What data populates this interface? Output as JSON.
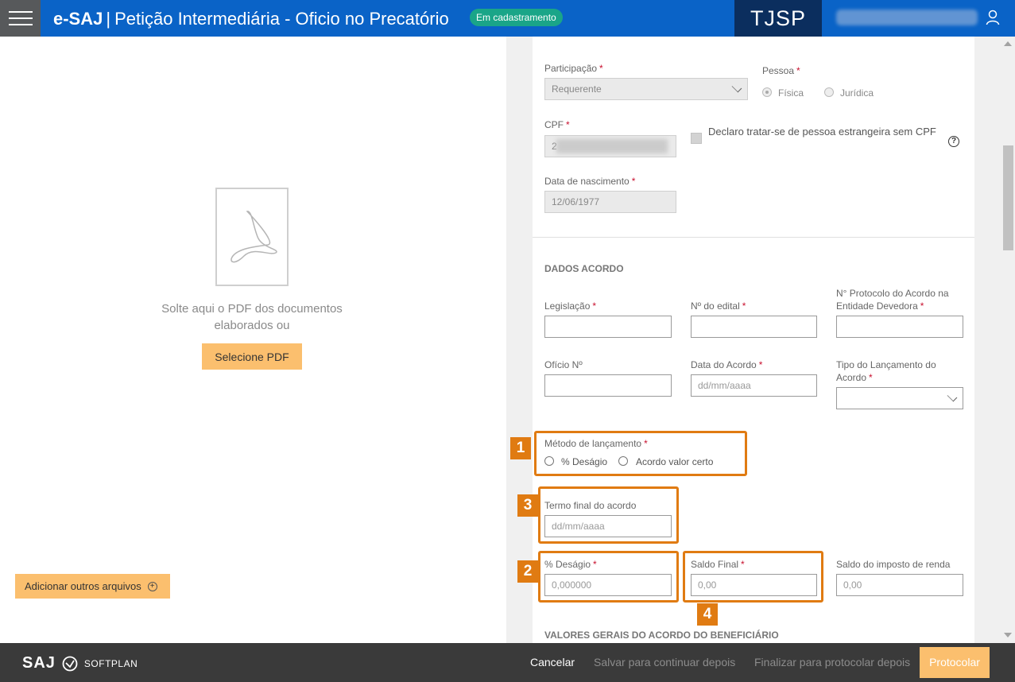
{
  "header": {
    "brand": "e-SAJ",
    "separator": "|",
    "title": "Petição Intermediária - Oficio no Precatório",
    "status_badge": "Em cadastramento",
    "court": "TJSP",
    "menu_icon": "hamburger-menu-icon",
    "user_icon": "user-icon"
  },
  "drop_zone": {
    "icon": "pdf-file-icon",
    "text": "Solte aqui o PDF dos documentos elaborados ou",
    "select_button": "Selecione PDF",
    "add_files_button": "Adicionar outros arquivos",
    "add_icon": "plus-circle-icon"
  },
  "form": {
    "participacao": {
      "label": "Participação",
      "value": "Requerente"
    },
    "pessoa": {
      "label": "Pessoa",
      "options": [
        "Física",
        "Jurídica"
      ],
      "selected": "Física"
    },
    "cpf": {
      "label": "CPF",
      "value": "2"
    },
    "estrangeira": {
      "label": "Declaro tratar-se de pessoa estrangeira sem CPF"
    },
    "nascimento": {
      "label": "Data de nascimento",
      "value": "12/06/1977"
    },
    "section_dados_acordo": "DADOS ACORDO",
    "legislacao": {
      "label": "Legislação"
    },
    "edital": {
      "label": "Nº do edital"
    },
    "protocolo": {
      "label": "N° Protocolo do Acordo na Entidade Devedora"
    },
    "oficio": {
      "label": "Ofício Nº"
    },
    "data_acordo": {
      "label": "Data do Acordo",
      "placeholder": "dd/mm/aaaa"
    },
    "tipo_lancamento": {
      "label": "Tipo do Lançamento do Acordo"
    },
    "metodo": {
      "label": "Método de lançamento",
      "options": [
        "% Deságio",
        "Acordo valor certo"
      ]
    },
    "termo_final": {
      "label": "Termo final do acordo",
      "placeholder": "dd/mm/aaaa"
    },
    "desagio": {
      "label": "% Deságio",
      "placeholder": "0,000000"
    },
    "saldo_final": {
      "label": "Saldo Final",
      "placeholder": "0,00"
    },
    "saldo_imposto": {
      "label": "Saldo do imposto de renda",
      "placeholder": "0,00"
    },
    "section_valores": "VALORES GERAIS DO ACORDO DO BENEFICIÁRIO"
  },
  "callouts": [
    "1",
    "2",
    "3",
    "4"
  ],
  "footer": {
    "logo_saj": "SAJ",
    "logo_softplan": "SOFTPLAN",
    "cancel": "Cancelar",
    "save": "Salvar para continuar depois",
    "finalize": "Finalizar para protocolar depois",
    "protocol": "Protocolar"
  },
  "colors": {
    "header_blue": "#0a63c7",
    "court_navy": "#0b2e5e",
    "badge_green": "#1aa588",
    "button_orange": "#fbbf6e",
    "callout_orange": "#e07b12",
    "required_red": "#c8102e",
    "footer_dark": "#3a3a3a"
  }
}
